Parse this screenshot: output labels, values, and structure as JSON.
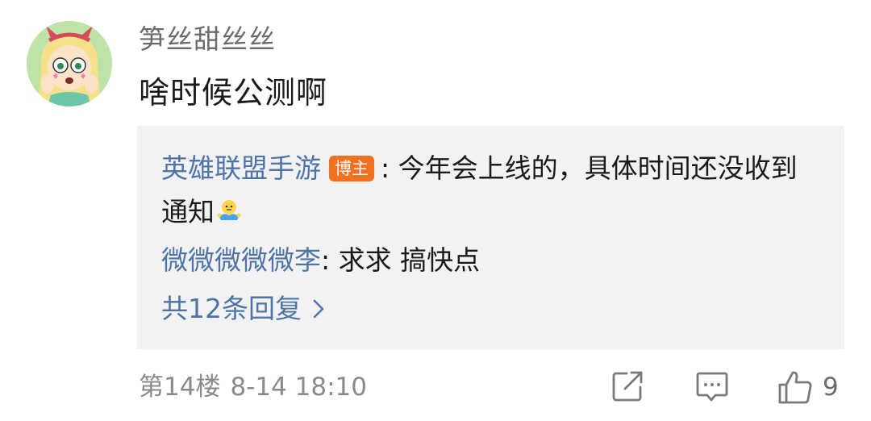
{
  "comment": {
    "username": "笋丝甜丝丝",
    "content": "啥时候公测啊"
  },
  "replies": [
    {
      "name": "英雄联盟手游",
      "badge": "博主",
      "separator": ": ",
      "text": "今年会上线的，具体时间还没收到通知",
      "emoji": "shrug-emoji"
    },
    {
      "name": "微微微微微李",
      "separator": ": ",
      "text": "求求 搞快点"
    }
  ],
  "more_replies_label": "共12条回复",
  "meta": {
    "floor": "第14楼",
    "datetime": "8-14 18:10"
  },
  "actions": {
    "share_icon": "share-icon",
    "comment_icon": "comment-icon",
    "like_icon": "thumbs-up-icon",
    "like_count": "9"
  },
  "colors": {
    "link_blue": "#4f74a8",
    "badge_orange": "#f27120",
    "reply_bg": "#f2f2f2",
    "meta_gray": "#8a8a8a"
  }
}
